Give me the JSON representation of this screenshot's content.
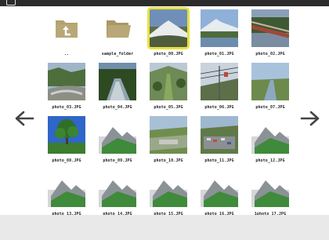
{
  "window": {
    "title_icon": "camera-icon"
  },
  "navigation": {
    "prev_icon": "arrow-left-icon",
    "next_icon": "arrow-right-icon"
  },
  "colors": {
    "selection": "#e9e13f",
    "folder": "#b3a270",
    "footer": "#e9e9e9",
    "topbar": "#2b2b2b"
  },
  "items": [
    {
      "label": "..",
      "kind": "parent-folder"
    },
    {
      "label": "sample_folder",
      "kind": "folder"
    },
    {
      "label": "photo_00.JPG",
      "kind": "mountain-snow",
      "selected": true
    },
    {
      "label": "photo_01.JPG",
      "kind": "mountain-lake"
    },
    {
      "label": "photo_02.JPG",
      "kind": "bridge"
    },
    {
      "label": "photo_03.JPG",
      "kind": "river"
    },
    {
      "label": "photo_04.JPG",
      "kind": "river-trees"
    },
    {
      "label": "photo_05.JPG",
      "kind": "valley"
    },
    {
      "label": "photo_06.JPG",
      "kind": "ropeway"
    },
    {
      "label": "photo_07.JPG",
      "kind": "river-plain"
    },
    {
      "label": "photo_08.JPG",
      "kind": "tree"
    },
    {
      "label": "photo_09.JPG",
      "kind": "placeholder"
    },
    {
      "label": "photo_10.JPG",
      "kind": "field"
    },
    {
      "label": "photo_11.JPG",
      "kind": "parking"
    },
    {
      "label": "photo_12.JPG",
      "kind": "placeholder"
    },
    {
      "label": "photo_13.JPG",
      "kind": "placeholder"
    },
    {
      "label": "photo_14.JPG",
      "kind": "placeholder"
    },
    {
      "label": "photo_15.JPG",
      "kind": "placeholder"
    },
    {
      "label": "photo_16.JPG",
      "kind": "placeholder"
    },
    {
      "label": "1photo_17.JPG",
      "kind": "placeholder"
    }
  ]
}
